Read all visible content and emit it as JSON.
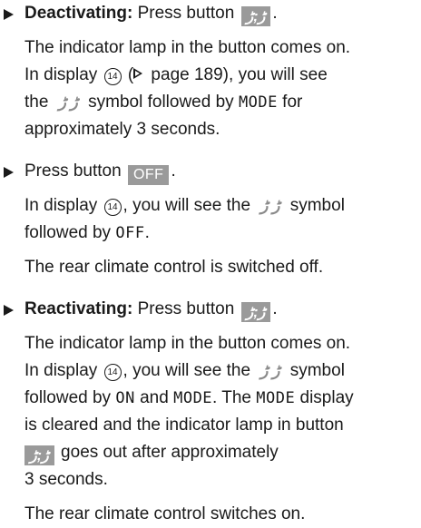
{
  "symbols": {
    "button_glyph": "ڑ;ڑ",
    "inline_symbol": "ڑ ڑ",
    "display_number": "14",
    "page_ref_icon": "triangle-right-outline-icon"
  },
  "block1": {
    "label": "Deactivating:",
    "text_before_button": " Press button ",
    "after_button": ".",
    "line2": "The indicator lamp in the button comes on.",
    "line3_pre": "In display ",
    "line3_mid": " (",
    "line3_post": " page 189), you will see",
    "line4_pre": "the ",
    "line4_post": " symbol followed by ",
    "mode": "MODE",
    "line4_end": " for",
    "line5": "approximately 3 seconds."
  },
  "block2": {
    "text_before_button": "Press button ",
    "button_label": "OFF",
    "after_button": ".",
    "line2_pre": "In display ",
    "line2_mid": ", you will see the ",
    "line2_post": " symbol",
    "line3_pre": "followed by ",
    "off": "OFF",
    "line3_end": ".",
    "line4": "The rear climate control is switched off."
  },
  "block3": {
    "label": "Reactivating:",
    "text_before_button": " Press button ",
    "after_button": ".",
    "line2": "The indicator lamp in the button comes on.",
    "line3_pre": "In display ",
    "line3_mid": ", you will see the ",
    "line3_post": " symbol",
    "line4_pre": "followed by ",
    "on": "ON",
    "line4_and": " and ",
    "mode": "MODE",
    "line4_mid": ". The ",
    "mode2": "MODE",
    "line4_end": " display",
    "line5": "is cleared and the indicator lamp in button",
    "line6_post": " goes out after approximately",
    "line7": "3 seconds.",
    "line8": "The rear climate control switches on."
  }
}
